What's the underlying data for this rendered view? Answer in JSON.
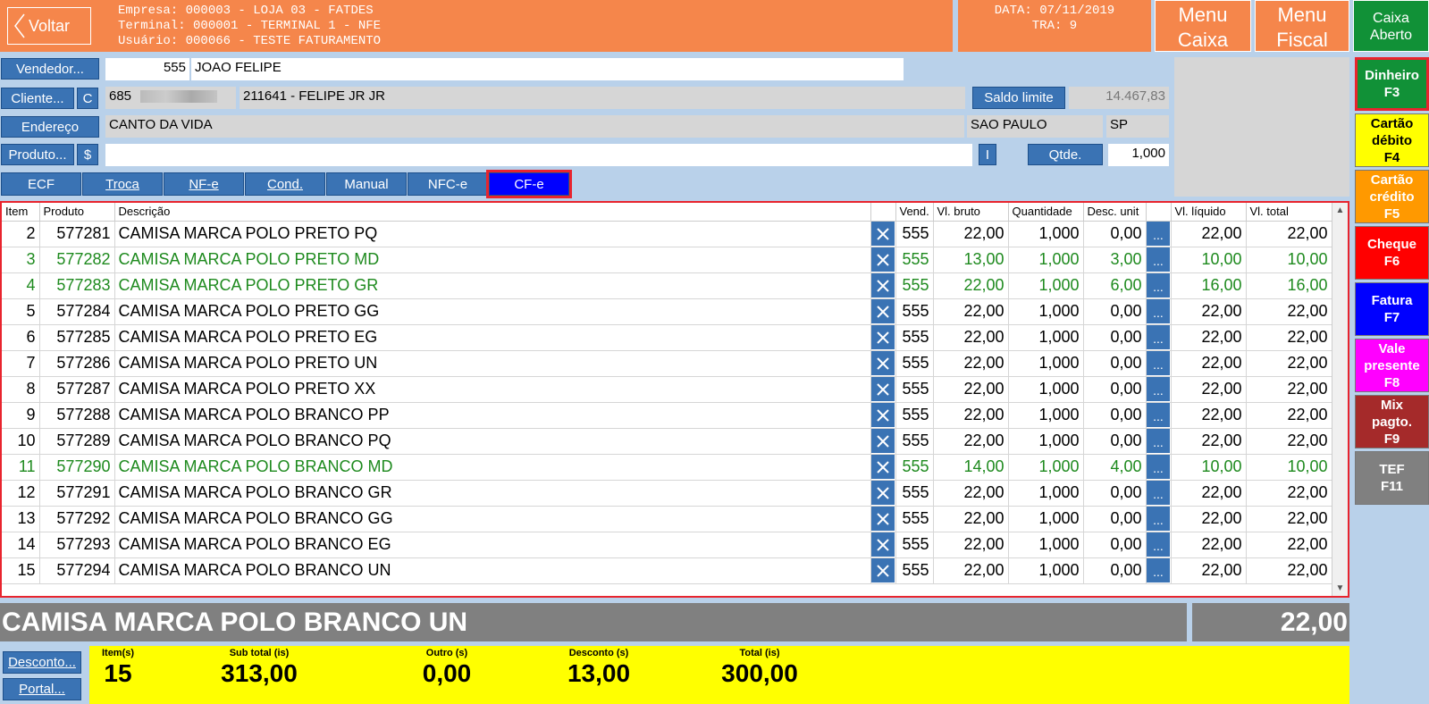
{
  "header": {
    "back_label": "Voltar",
    "empresa": "Empresa: 000003 - LOJA 03 - FATDES",
    "terminal": "Terminal: 000001 - TERMINAL 1 - NFE",
    "usuario": "Usuário: 000066 - TESTE FATURAMENTO",
    "data": "DATA: 07/11/2019",
    "tra": "TRA: 9",
    "menu_caixa_1": "Menu",
    "menu_caixa_2": "Caixa",
    "menu_fiscal_1": "Menu",
    "menu_fiscal_2": "Fiscal",
    "caixa_aberto_1": "Caixa",
    "caixa_aberto_2": "Aberto"
  },
  "form": {
    "vendedor_btn": "Vendedor...",
    "vendedor_code": "555",
    "vendedor_name": "JOAO FELIPE",
    "cliente_btn": "Cliente...",
    "cliente_c_btn": "C",
    "cliente_code": "685",
    "cliente_name": "211641 - FELIPE JR JR",
    "saldo_btn": "Saldo limite",
    "saldo_value": "14.467,83",
    "endereco_btn": "Endereço",
    "endereco": "CANTO DA VIDA",
    "cidade": "SAO PAULO",
    "uf": "SP",
    "produto_btn": "Produto...",
    "produto_dollar_btn": "$",
    "produto_value": "",
    "i_btn": "I",
    "qtde_btn": "Qtde.",
    "qtde_value": "1,000"
  },
  "tabs": [
    "ECF",
    "Troca",
    "NF-e",
    "Cond.",
    "Manual",
    "NFC-e",
    "CF-e"
  ],
  "table": {
    "headers": [
      "Item",
      "Produto",
      "Descrição",
      "",
      "Vend.",
      "Vl. bruto",
      "Quantidade",
      "Desc. unit",
      "",
      "Vl. líquido",
      "Vl. total"
    ],
    "rows": [
      {
        "item": "2",
        "produto": "577281",
        "desc": "CAMISA MARCA POLO PRETO PQ",
        "vend": "555",
        "bruto": "22,00",
        "qtd": "1,000",
        "desc_unit": "0,00",
        "liq": "22,00",
        "total": "22,00",
        "green": false
      },
      {
        "item": "3",
        "produto": "577282",
        "desc": "CAMISA MARCA POLO PRETO MD",
        "vend": "555",
        "bruto": "13,00",
        "qtd": "1,000",
        "desc_unit": "3,00",
        "liq": "10,00",
        "total": "10,00",
        "green": true
      },
      {
        "item": "4",
        "produto": "577283",
        "desc": "CAMISA MARCA POLO PRETO GR",
        "vend": "555",
        "bruto": "22,00",
        "qtd": "1,000",
        "desc_unit": "6,00",
        "liq": "16,00",
        "total": "16,00",
        "green": true
      },
      {
        "item": "5",
        "produto": "577284",
        "desc": "CAMISA MARCA POLO PRETO GG",
        "vend": "555",
        "bruto": "22,00",
        "qtd": "1,000",
        "desc_unit": "0,00",
        "liq": "22,00",
        "total": "22,00",
        "green": false
      },
      {
        "item": "6",
        "produto": "577285",
        "desc": "CAMISA MARCA POLO PRETO EG",
        "vend": "555",
        "bruto": "22,00",
        "qtd": "1,000",
        "desc_unit": "0,00",
        "liq": "22,00",
        "total": "22,00",
        "green": false
      },
      {
        "item": "7",
        "produto": "577286",
        "desc": "CAMISA MARCA POLO PRETO UN",
        "vend": "555",
        "bruto": "22,00",
        "qtd": "1,000",
        "desc_unit": "0,00",
        "liq": "22,00",
        "total": "22,00",
        "green": false
      },
      {
        "item": "8",
        "produto": "577287",
        "desc": "CAMISA MARCA POLO PRETO XX",
        "vend": "555",
        "bruto": "22,00",
        "qtd": "1,000",
        "desc_unit": "0,00",
        "liq": "22,00",
        "total": "22,00",
        "green": false
      },
      {
        "item": "9",
        "produto": "577288",
        "desc": "CAMISA MARCA POLO BRANCO PP",
        "vend": "555",
        "bruto": "22,00",
        "qtd": "1,000",
        "desc_unit": "0,00",
        "liq": "22,00",
        "total": "22,00",
        "green": false
      },
      {
        "item": "10",
        "produto": "577289",
        "desc": "CAMISA MARCA POLO BRANCO PQ",
        "vend": "555",
        "bruto": "22,00",
        "qtd": "1,000",
        "desc_unit": "0,00",
        "liq": "22,00",
        "total": "22,00",
        "green": false
      },
      {
        "item": "11",
        "produto": "577290",
        "desc": "CAMISA MARCA POLO BRANCO MD",
        "vend": "555",
        "bruto": "14,00",
        "qtd": "1,000",
        "desc_unit": "4,00",
        "liq": "10,00",
        "total": "10,00",
        "green": true
      },
      {
        "item": "12",
        "produto": "577291",
        "desc": "CAMISA MARCA POLO BRANCO GR",
        "vend": "555",
        "bruto": "22,00",
        "qtd": "1,000",
        "desc_unit": "0,00",
        "liq": "22,00",
        "total": "22,00",
        "green": false
      },
      {
        "item": "13",
        "produto": "577292",
        "desc": "CAMISA MARCA POLO BRANCO GG",
        "vend": "555",
        "bruto": "22,00",
        "qtd": "1,000",
        "desc_unit": "0,00",
        "liq": "22,00",
        "total": "22,00",
        "green": false
      },
      {
        "item": "14",
        "produto": "577293",
        "desc": "CAMISA MARCA POLO BRANCO EG",
        "vend": "555",
        "bruto": "22,00",
        "qtd": "1,000",
        "desc_unit": "0,00",
        "liq": "22,00",
        "total": "22,00",
        "green": false
      },
      {
        "item": "15",
        "produto": "577294",
        "desc": "CAMISA MARCA POLO BRANCO UN",
        "vend": "555",
        "bruto": "22,00",
        "qtd": "1,000",
        "desc_unit": "0,00",
        "liq": "22,00",
        "total": "22,00",
        "green": false
      }
    ]
  },
  "current": {
    "description": "CAMISA MARCA POLO BRANCO UN",
    "total": "22,00"
  },
  "bottom": {
    "desconto_btn": "Desconto...",
    "portal_btn": "Portal...",
    "itens_label": "Item(s)",
    "itens_value": "15",
    "subtotal_label": "Sub total (is)",
    "subtotal_value": "313,00",
    "outro_label": "Outro (s)",
    "outro_value": "0,00",
    "desconto_label": "Desconto (s)",
    "desconto_value": "13,00",
    "total_label": "Total (is)",
    "total_value": "300,00"
  },
  "payments": [
    {
      "l1": "Dinheiro",
      "l2": "F3",
      "l3": "",
      "color": "#119137",
      "text": "#ffffff"
    },
    {
      "l1": "Cartão",
      "l2": "débito",
      "l3": "F4",
      "color": "#ffff00",
      "text": "#000000"
    },
    {
      "l1": "Cartão",
      "l2": "crédito",
      "l3": "F5",
      "color": "#ff9900",
      "text": "#ffffff"
    },
    {
      "l1": "Cheque",
      "l2": "F6",
      "l3": "",
      "color": "#ff0000",
      "text": "#ffffff"
    },
    {
      "l1": "Fatura",
      "l2": "F7",
      "l3": "",
      "color": "#0000ff",
      "text": "#ffffff"
    },
    {
      "l1": "Vale",
      "l2": "presente",
      "l3": "F8",
      "color": "#ff00ff",
      "text": "#ffffff"
    },
    {
      "l1": "Mix",
      "l2": "pagto.",
      "l3": "F9",
      "color": "#a52a2a",
      "text": "#ffffff"
    },
    {
      "l1": "TEF",
      "l2": "F11",
      "l3": "",
      "color": "#808080",
      "text": "#ffffff"
    }
  ],
  "colors": {
    "header_orange": "#f5864b",
    "button_blue": "#3a73b4",
    "highlight_red": "#e8242e",
    "discount_green": "#1e8a1e",
    "totals_yellow": "#ffff00"
  }
}
